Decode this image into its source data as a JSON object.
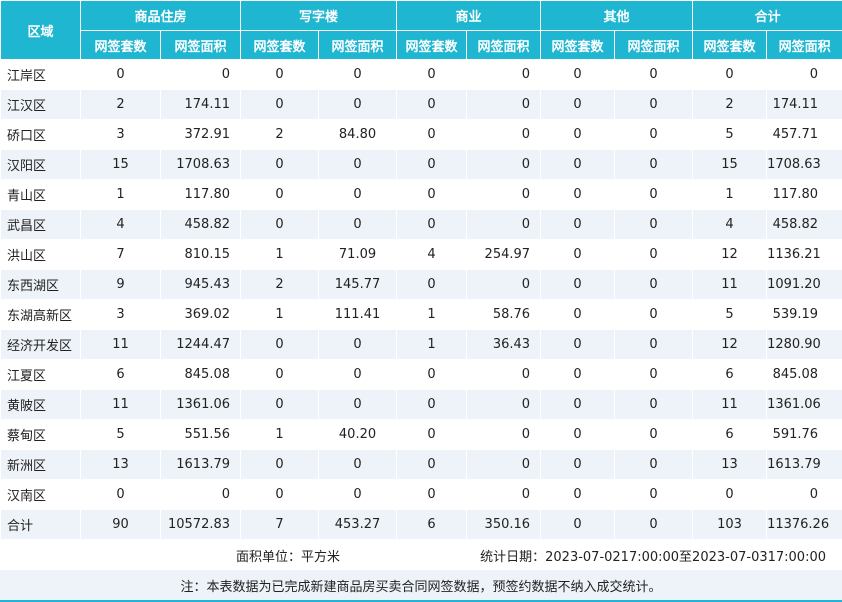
{
  "header": {
    "region": "区域",
    "groups": [
      "商品住房",
      "写字楼",
      "商业",
      "其他",
      "合计"
    ],
    "sub": [
      "网签套数",
      "网签面积"
    ]
  },
  "rows": [
    [
      "江岸区",
      "0",
      "0",
      "0",
      "0",
      "0",
      "0",
      "0",
      "0",
      "0",
      "0"
    ],
    [
      "江汉区",
      "2",
      "174.11",
      "0",
      "0",
      "0",
      "0",
      "0",
      "0",
      "2",
      "174.11"
    ],
    [
      "硚口区",
      "3",
      "372.91",
      "2",
      "84.80",
      "0",
      "0",
      "0",
      "0",
      "5",
      "457.71"
    ],
    [
      "汉阳区",
      "15",
      "1708.63",
      "0",
      "0",
      "0",
      "0",
      "0",
      "0",
      "15",
      "1708.63"
    ],
    [
      "青山区",
      "1",
      "117.80",
      "0",
      "0",
      "0",
      "0",
      "0",
      "0",
      "1",
      "117.80"
    ],
    [
      "武昌区",
      "4",
      "458.82",
      "0",
      "0",
      "0",
      "0",
      "0",
      "0",
      "4",
      "458.82"
    ],
    [
      "洪山区",
      "7",
      "810.15",
      "1",
      "71.09",
      "4",
      "254.97",
      "0",
      "0",
      "12",
      "1136.21"
    ],
    [
      "东西湖区",
      "9",
      "945.43",
      "2",
      "145.77",
      "0",
      "0",
      "0",
      "0",
      "11",
      "1091.20"
    ],
    [
      "东湖高新区",
      "3",
      "369.02",
      "1",
      "111.41",
      "1",
      "58.76",
      "0",
      "0",
      "5",
      "539.19"
    ],
    [
      "经济开发区",
      "11",
      "1244.47",
      "0",
      "0",
      "1",
      "36.43",
      "0",
      "0",
      "12",
      "1280.90"
    ],
    [
      "江夏区",
      "6",
      "845.08",
      "0",
      "0",
      "0",
      "0",
      "0",
      "0",
      "6",
      "845.08"
    ],
    [
      "黄陂区",
      "11",
      "1361.06",
      "0",
      "0",
      "0",
      "0",
      "0",
      "0",
      "11",
      "1361.06"
    ],
    [
      "蔡甸区",
      "5",
      "551.56",
      "1",
      "40.20",
      "0",
      "0",
      "0",
      "0",
      "6",
      "591.76"
    ],
    [
      "新洲区",
      "13",
      "1613.79",
      "0",
      "0",
      "0",
      "0",
      "0",
      "0",
      "13",
      "1613.79"
    ],
    [
      "汉南区",
      "0",
      "0",
      "0",
      "0",
      "0",
      "0",
      "0",
      "0",
      "0",
      "0"
    ],
    [
      "合计",
      "90",
      "10572.83",
      "7",
      "453.27",
      "6",
      "350.16",
      "0",
      "0",
      "103",
      "11376.26"
    ]
  ],
  "footer": {
    "unit": "面积单位：平方米",
    "period": "统计日期：2023-07-0217:00:00至2023-07-0317:00:00",
    "note": "注：本表数据为已完成新建商品房买卖合同网签数据，预签约数据不纳入成交统计。"
  }
}
